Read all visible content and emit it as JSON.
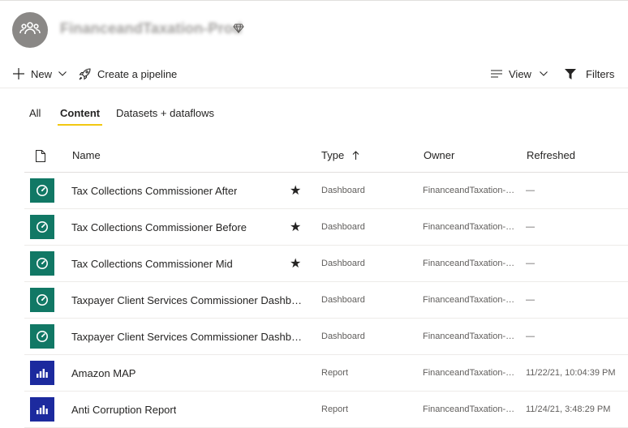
{
  "workspace": {
    "title": "FinanceandTaxation-Prod",
    "avatar_icon": "people-group-icon",
    "premium_icon": "diamond-icon"
  },
  "toolbar": {
    "new_label": "New",
    "create_pipeline_label": "Create a pipeline",
    "view_label": "View",
    "filters_label": "Filters"
  },
  "tabs": [
    {
      "label": "All",
      "active": false
    },
    {
      "label": "Content",
      "active": true
    },
    {
      "label": "Datasets + dataflows",
      "active": false
    }
  ],
  "table": {
    "columns": {
      "name": "Name",
      "type": "Type",
      "owner": "Owner",
      "refreshed": "Refreshed"
    },
    "rows": [
      {
        "name": "Tax Collections Commissioner After",
        "favorite": "★",
        "type": "Dashboard",
        "owner": "FinanceandTaxation-P...",
        "refreshed": "—",
        "kind": "dashboard"
      },
      {
        "name": "Tax Collections Commissioner Before",
        "favorite": "★",
        "type": "Dashboard",
        "owner": "FinanceandTaxation-P...",
        "refreshed": "—",
        "kind": "dashboard"
      },
      {
        "name": "Tax Collections Commissioner Mid",
        "favorite": "★",
        "type": "Dashboard",
        "owner": "FinanceandTaxation-P...",
        "refreshed": "—",
        "kind": "dashboard"
      },
      {
        "name": "Taxpayer Client Services Commissioner Dashboard ...",
        "favorite": "",
        "type": "Dashboard",
        "owner": "FinanceandTaxation-P...",
        "refreshed": "—",
        "kind": "dashboard"
      },
      {
        "name": "Taxpayer Client Services Commissioner Dashboard ...",
        "favorite": "",
        "type": "Dashboard",
        "owner": "FinanceandTaxation-P...",
        "refreshed": "—",
        "kind": "dashboard"
      },
      {
        "name": "Amazon MAP",
        "favorite": "",
        "type": "Report",
        "owner": "FinanceandTaxation-P...",
        "refreshed": "11/22/21, 10:04:39 PM",
        "kind": "report"
      },
      {
        "name": "Anti Corruption Report",
        "favorite": "",
        "type": "Report",
        "owner": "FinanceandTaxation-P...",
        "refreshed": "11/24/21, 3:48:29 PM",
        "kind": "report"
      }
    ]
  },
  "colors": {
    "dashboard_tile": "#117865",
    "report_tile": "#1c2a9e",
    "tab_underline": "#f2c811"
  }
}
